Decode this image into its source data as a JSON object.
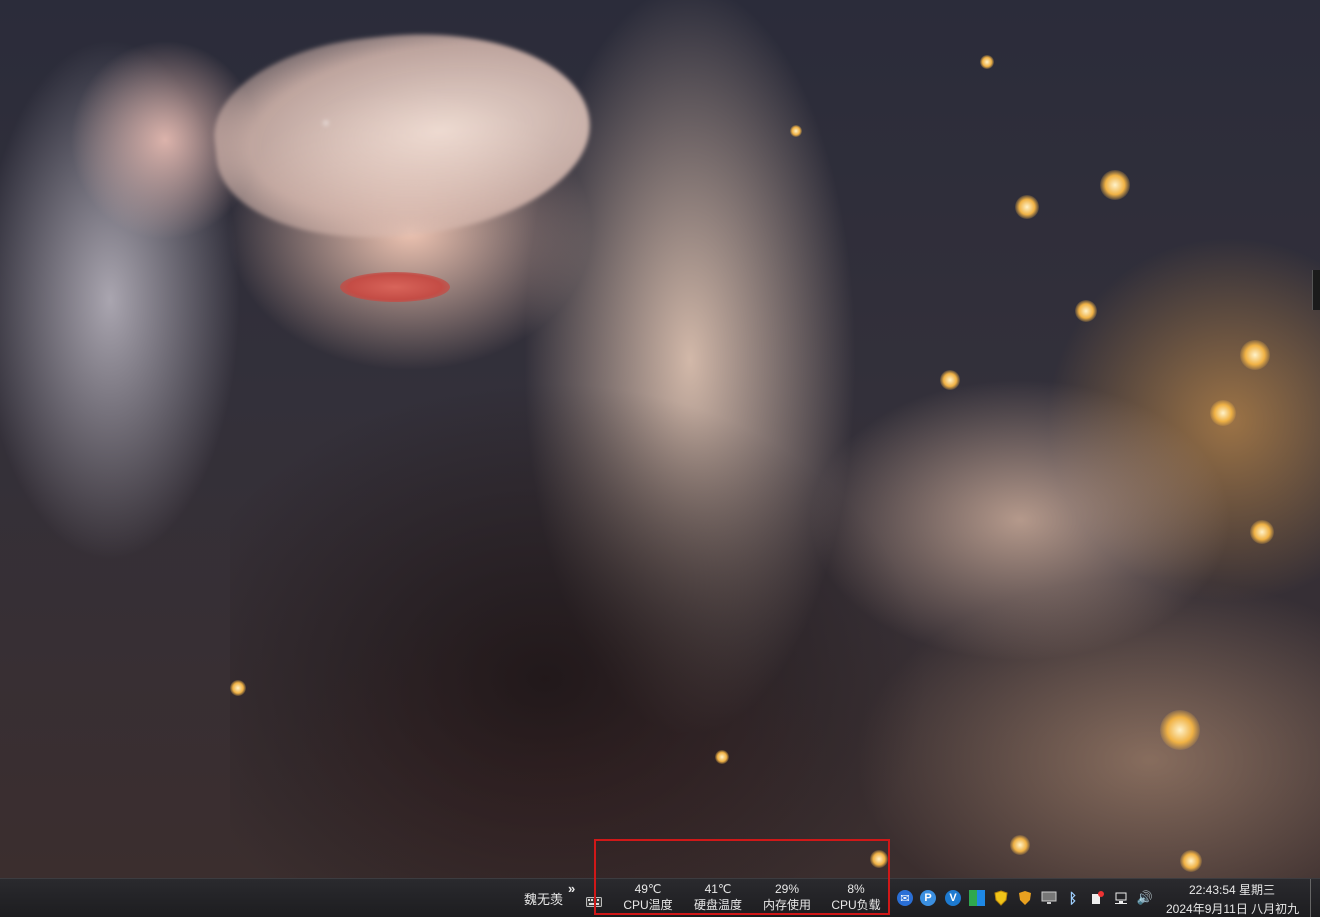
{
  "wallpaper": {
    "description_icon": "anime-wallpaper"
  },
  "taskbar": {
    "user_label": "魏无羡",
    "overflow_glyph": "»",
    "stats": [
      {
        "value": "49℃",
        "label": "CPU温度"
      },
      {
        "value": "41℃",
        "label": "硬盘温度"
      },
      {
        "value": "29%",
        "label": "内存使用"
      },
      {
        "value": "8%",
        "label": "CPU负载"
      }
    ],
    "tray_glyphs": {
      "chat": "✉",
      "p_app": "P",
      "v_app": "V",
      "bluetooth": "ᛒ",
      "volume": "🔊"
    },
    "clock": {
      "time": "22:43:54 星期三",
      "date": "2024年9月11日 八月初九"
    }
  },
  "colors": {
    "highlight_border": "#d01818",
    "taskbar_bg": "#1d1d20",
    "taskbar_text": "#e8e8e8"
  }
}
